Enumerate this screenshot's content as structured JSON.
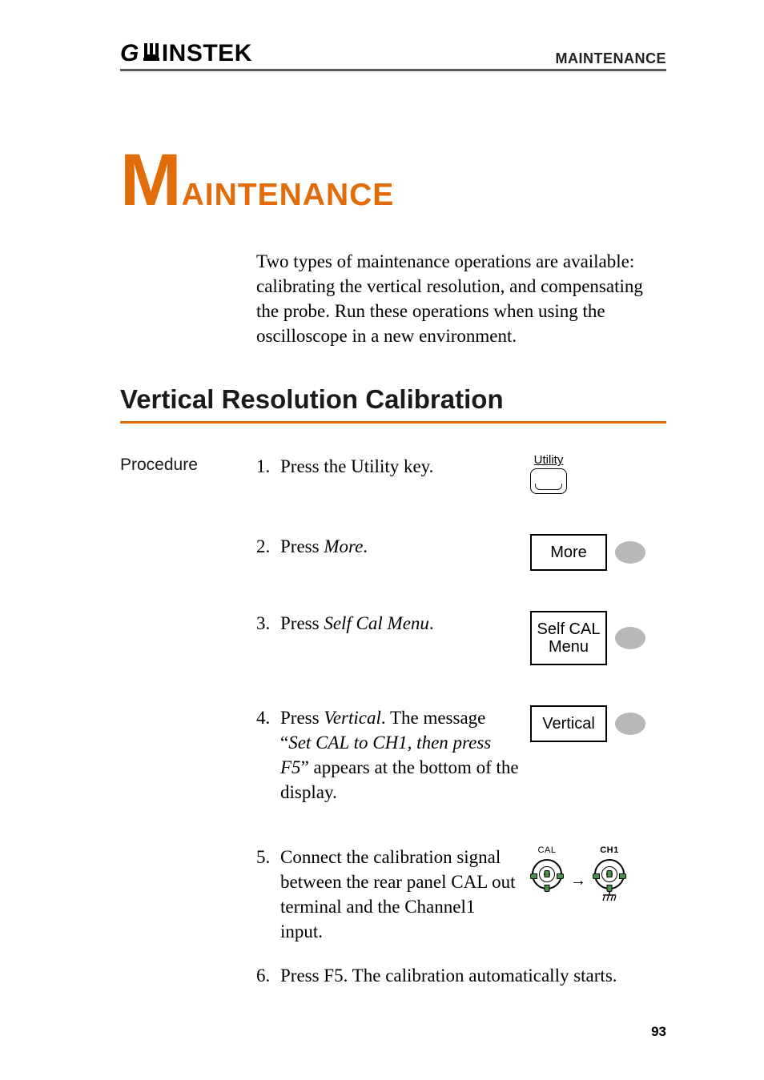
{
  "header": {
    "brand_prefix": "G",
    "brand_suffix": "INSTEK",
    "section": "MAINTENANCE"
  },
  "chapter": {
    "big_letter": "M",
    "rest": "AINTENANCE"
  },
  "intro": "Two types of maintenance operations are available: calibrating the vertical resolution, and compensating the probe. Run these operations when using the oscilloscope in a new environment.",
  "section_heading": "Vertical Resolution Calibration",
  "procedure_label": "Procedure",
  "steps": [
    {
      "num": "1.",
      "pre": "Press the Utility key.",
      "button_cap": "Utility"
    },
    {
      "num": "2.",
      "pre": "Press ",
      "em": "More",
      "post": ".",
      "soft_label": "More"
    },
    {
      "num": "3.",
      "pre": "Press ",
      "em": "Self Cal Menu",
      "post": ".",
      "soft_label": "Self CAL\nMenu"
    },
    {
      "num": "4.",
      "pre": "Press ",
      "em": "Vertical",
      "mid": ". The message “",
      "em2": "Set CAL to CH1, then press F5",
      "post": "” appears at the bottom of the display.",
      "soft_label": "Vertical"
    },
    {
      "num": "5.",
      "text": "Connect the calibration signal between the rear panel CAL out terminal and the Channel1 input.",
      "bnc_left": "CAL",
      "bnc_right": "CH1"
    },
    {
      "num": "6.",
      "text": "Press F5. The calibration automatically starts."
    }
  ],
  "page_number": "93"
}
